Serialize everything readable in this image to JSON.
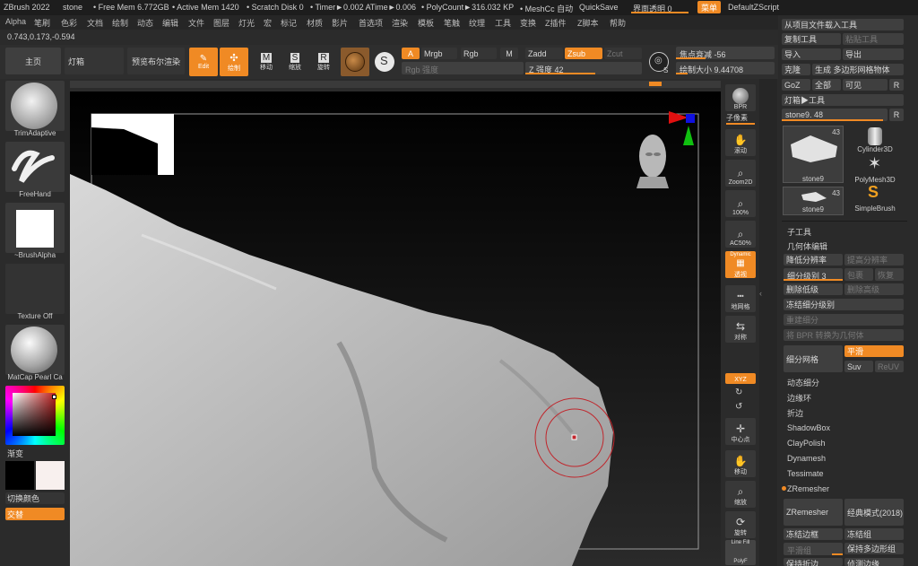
{
  "title": {
    "app": "ZBrush 2022",
    "doc": "stone",
    "free_mem": "• Free Mem 6.772GB",
    "active_mem": "• Active Mem 1420",
    "scratch": "• Scratch Disk 0",
    "timer": "• Timer►0.002 ATime►0.006",
    "polycount": "• PolyCount►316.032 KP",
    "meshcc": "• MeshCc 自动",
    "quicksave": "QuickSave",
    "ui_opacity": "界面透明 0",
    "menu_btn": "菜单",
    "script": "DefaultZScript"
  },
  "menus": [
    "Alpha",
    "笔刷",
    "色彩",
    "文档",
    "绘制",
    "动态",
    "编辑",
    "文件",
    "图层",
    "灯光",
    "宏",
    "标记",
    "材质",
    "影片",
    "首选项",
    "渲染",
    "模板",
    "笔触",
    "纹理",
    "工具",
    "变换",
    "Z插件",
    "Z脚本",
    "帮助"
  ],
  "coords": "0.743,0.173,-0.594",
  "shelf": {
    "home": "主页",
    "lightbox": "灯箱",
    "preview_render": "预览布尔渲染",
    "edit": "Edit",
    "draw": "绘制",
    "move": "移动",
    "scale": "缩放",
    "rotate": "旋转",
    "a": "A",
    "mrgb": "Mrgb",
    "rgb": "Rgb",
    "m": "M",
    "rgb_intensity": "Rgb 强度",
    "zadd": "Zadd",
    "zsub": "Zsub",
    "zcut": "Zcut",
    "z_intensity": "Z 强度 42",
    "focal": "焦点衰减 -56",
    "draw_size": "绘制大小 9.44708",
    "s_label": "S"
  },
  "left": {
    "brush": "TrimAdaptive",
    "stroke": "FreeHand",
    "alpha": "~BrushAlpha",
    "texture": "Texture Off",
    "material": "MatCap Pearl Ca",
    "gradient": "渐变",
    "switch_color": "切换颜色",
    "alternate": "交替"
  },
  "right": {
    "bpr": "BPR",
    "subpixel": "子像素",
    "scroll": "滚动",
    "zoom2d": "Zoom2D",
    "p100": "100%",
    "ac50": "AC50%",
    "dynamic": "Dynamic",
    "persp": "透视",
    "floor": "地网格",
    "local": "对称",
    "xyz": "XYZ",
    "center": "中心点",
    "move": "移动",
    "scale": "缩放",
    "rotate": "旋转",
    "linefill": "Line Fill",
    "polyf": "PolyF"
  },
  "tray": {
    "load_tool": "从项目文件载入工具",
    "copy_tool": "复制工具",
    "paste_tool": "粘贴工具",
    "import": "导入",
    "export": "导出",
    "clone": "克隆",
    "make_polymesh": "生成 多边形网格物体",
    "goz": "GoZ",
    "all": "全部",
    "visible": "可见",
    "r": "R",
    "lightbox_tools": "灯箱▶工具",
    "tool_slider": "stone9. 48",
    "thumb1_name": "stone9",
    "thumb1_count": "43",
    "thumb2_name": "Cylinder3D",
    "thumb3_name": "PolyMesh3D",
    "thumb4_name": "stone9",
    "thumb4_count": "43",
    "thumb5_name": "SimpleBrush",
    "subtool": "子工具",
    "geometry": "几何体编辑",
    "lower_res": "降低分辨率",
    "higher_res": "提高分辨率",
    "sdiv": "细分级别 3",
    "cage": "包裹",
    "rstr": "恢复",
    "del_lower": "删除低级",
    "del_higher": "删除高级",
    "freeze_sub": "冻结细分级别",
    "reconstruct": "重建细分",
    "bpr_to_geo": "将 BPR 转换为几何体",
    "divide": "细分网格",
    "smooth": "平滑",
    "suv": "Suv",
    "reuv": "ReUV",
    "dyn_sub": "动态细分",
    "edgeloop": "边缘环",
    "crease": "折边",
    "shadowbox": "ShadowBox",
    "claypolish": "ClayPolish",
    "dynamesh": "Dynamesh",
    "tessimate": "Tessimate",
    "zremesher_sec": "ZRemesher",
    "zremesher_btn": "ZRemesher",
    "legacy": "经典模式(2018)",
    "freeze_border": "冻结边框",
    "freeze_groups": "冻结组",
    "smooth_groups": "平滑组",
    "keep_groups": "保持多边形组",
    "keep_creases": "保持折边",
    "detect_edges": "侦测边缘"
  },
  "colors": {
    "accent": "#f08a24",
    "bg": "#2b2b2b",
    "viewport": "#050505"
  }
}
